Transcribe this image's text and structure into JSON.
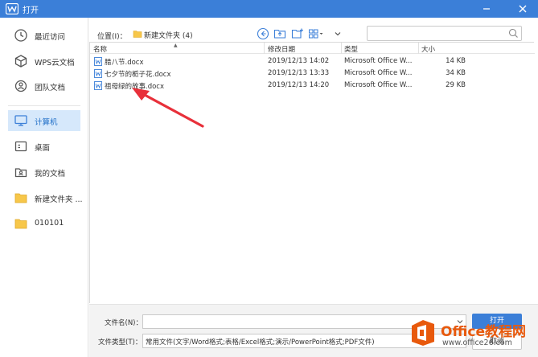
{
  "window": {
    "title": "打开"
  },
  "sidebar": {
    "items": [
      {
        "label": "最近访问",
        "icon": "clock-icon"
      },
      {
        "label": "WPS云文档",
        "icon": "cube-icon"
      },
      {
        "label": "团队文档",
        "icon": "team-icon"
      },
      {
        "label": "计算机",
        "icon": "monitor-icon",
        "active": true
      },
      {
        "label": "桌面",
        "icon": "desktop-icon"
      },
      {
        "label": "我的文档",
        "icon": "my-documents-icon"
      },
      {
        "label": "新建文件夹 ...",
        "icon": "folder-icon"
      },
      {
        "label": "010101",
        "icon": "folder-icon"
      }
    ]
  },
  "toolbar": {
    "location_label": "位置(I)：",
    "location_value": "新建文件夹 (4)",
    "search_placeholder": ""
  },
  "filelist": {
    "columns": [
      "名称",
      "修改日期",
      "类型",
      "大小"
    ],
    "rows": [
      {
        "name": "腊八节.docx",
        "date": "2019/12/13 14:02",
        "type": "Microsoft Office W...",
        "size": "14 KB"
      },
      {
        "name": "七夕节的栀子花.docx",
        "date": "2019/12/13 13:33",
        "type": "Microsoft Office W...",
        "size": "34 KB"
      },
      {
        "name": "祖母绿的故事.docx",
        "date": "2019/12/13 14:20",
        "type": "Microsoft Office W...",
        "size": "29 KB"
      }
    ]
  },
  "bottom": {
    "filename_label": "文件名(N)：",
    "filename_value": "",
    "filetype_label": "文件类型(T)：",
    "filetype_value": "常用文件(文字/Word格式;表格/Excel格式;演示/PowerPoint格式;PDF文件)",
    "open_label": "打开",
    "cancel_label": "取消"
  },
  "watermark": {
    "brand": "Office",
    "brand_cn": "教程网",
    "url": "www.office26.com"
  },
  "colors": {
    "titlebar": "#3b7fd8",
    "active_item": "#d6e8fb",
    "accent": "#1f6ec7",
    "annotation_arrow": "#e8303a",
    "watermark": "#e8590c"
  }
}
